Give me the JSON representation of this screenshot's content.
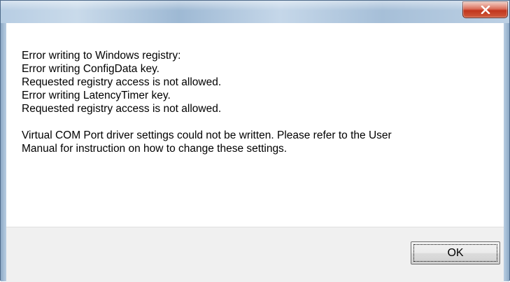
{
  "window": {
    "close_icon": "close-icon",
    "close_color": "#c1351d",
    "title_bar_color": "#b7cde3"
  },
  "message": {
    "lines": [
      "Error writing to Windows registry:",
      "Error writing ConfigData key.",
      "Requested registry access is not allowed.",
      "Error writing LatencyTimer key.",
      "Requested registry access is not allowed."
    ],
    "paragraph2_lines": [
      "Virtual COM Port driver settings could not be written. Please refer to the User",
      "Manual for instruction on how to change these settings."
    ]
  },
  "footer": {
    "ok_label": "OK",
    "background": "#f0f0f0"
  }
}
